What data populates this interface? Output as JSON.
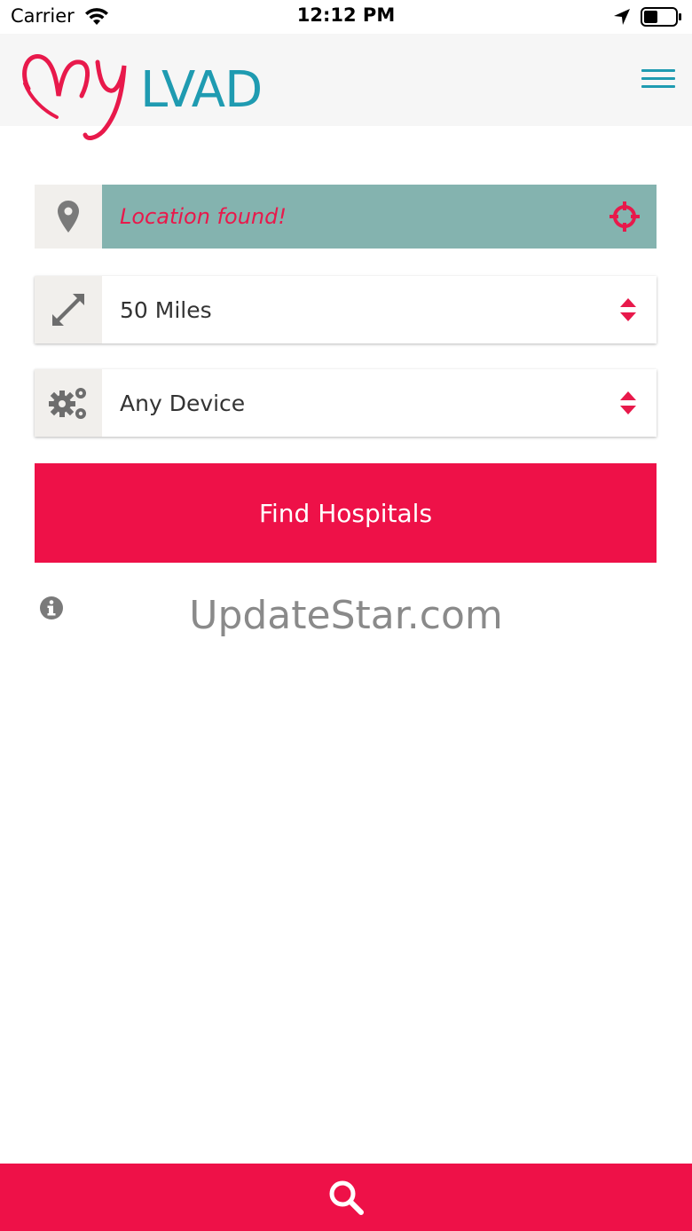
{
  "status_bar": {
    "carrier": "Carrier",
    "time": "12:12 PM"
  },
  "header": {
    "logo_text": "LVAD",
    "logo_script": "my"
  },
  "location": {
    "value": "Location found!"
  },
  "distance": {
    "selected": "50 Miles"
  },
  "device": {
    "selected": "Any Device"
  },
  "find_button": {
    "label": "Find Hospitals"
  },
  "watermark": {
    "text": "UpdateStar.com"
  },
  "colors": {
    "brand_red": "#ee1148",
    "brand_teal": "#1f9bb1",
    "location_bg": "#84b3af",
    "icon_box_bg": "#f1efec",
    "header_bg": "#f6f6f6"
  },
  "icons": {
    "status": [
      "wifi-icon",
      "location-arrow-icon",
      "battery-icon"
    ],
    "header": [
      "menu-icon"
    ],
    "rows": [
      "map-pin-icon",
      "crosshair-icon",
      "expand-arrows-icon",
      "select-arrows-icon",
      "gears-icon"
    ],
    "footer": [
      "info-icon",
      "search-icon"
    ]
  }
}
